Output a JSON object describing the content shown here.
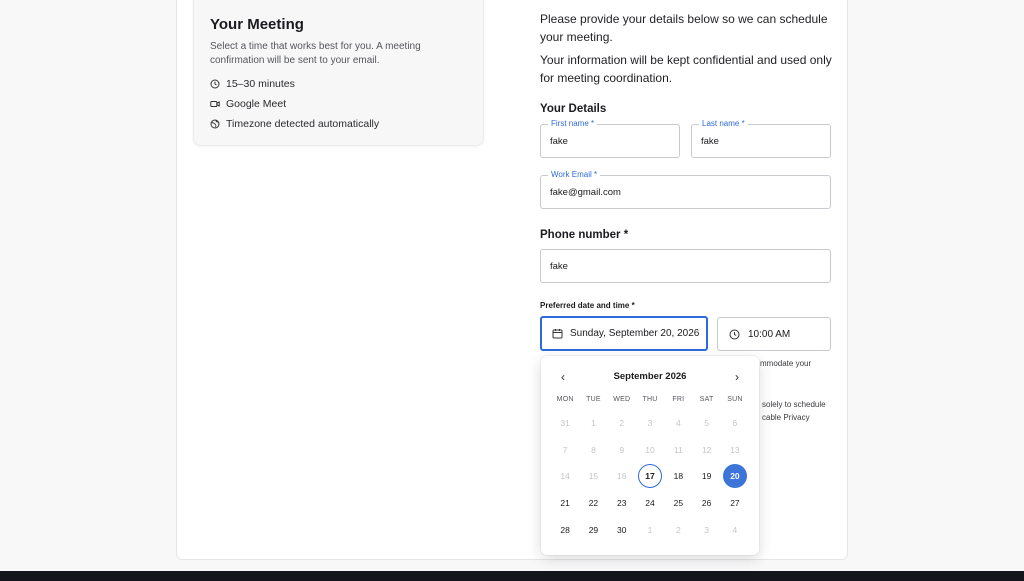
{
  "meeting": {
    "title": "Your Meeting",
    "description": "Select a time that works best for you. A meeting confirmation will be sent to your email.",
    "items": [
      {
        "icon": "clock-icon",
        "label": "15–30 minutes"
      },
      {
        "icon": "video-icon",
        "label": "Google Meet"
      },
      {
        "icon": "globe-icon",
        "label": "Timezone detected automatically"
      }
    ]
  },
  "intro": {
    "line1": "Please provide your details below so we can schedule your meeting.",
    "line2": "Your information will be kept confidential and used only for meeting coordination."
  },
  "details": {
    "title": "Your Details",
    "first_name": {
      "label": "First name *",
      "value": "fake"
    },
    "last_name": {
      "label": "Last name *",
      "value": "fake"
    },
    "work_email": {
      "label": "Work Email *",
      "value": "fake@gmail.com"
    }
  },
  "phone": {
    "title": "Phone number *",
    "value": "fake"
  },
  "datetime": {
    "label": "Preferred date and time *",
    "date_value": "Sunday, September 20, 2026",
    "time_value": "10:00 AM"
  },
  "hidden_text": {
    "frag1": "mmodate your",
    "frag2": "solely to schedule",
    "frag3": "cable Privacy"
  },
  "calendar": {
    "month_label": "September 2026",
    "prev": "‹",
    "next": "›",
    "weekdays": [
      "MON",
      "TUE",
      "WED",
      "THU",
      "FRI",
      "SAT",
      "SUN"
    ],
    "weeks": [
      [
        "31",
        "1",
        "2",
        "3",
        "4",
        "5",
        "6"
      ],
      [
        "7",
        "8",
        "9",
        "10",
        "11",
        "12",
        "13"
      ],
      [
        "14",
        "15",
        "16",
        "17",
        "18",
        "19",
        "20"
      ],
      [
        "21",
        "22",
        "23",
        "24",
        "25",
        "26",
        "27"
      ],
      [
        "28",
        "29",
        "30",
        "1",
        "2",
        "3",
        "4"
      ]
    ],
    "today": "17",
    "selected": "20"
  },
  "colors": {
    "accent": "#2f6bd8",
    "selected_bg": "#3c74d9"
  }
}
